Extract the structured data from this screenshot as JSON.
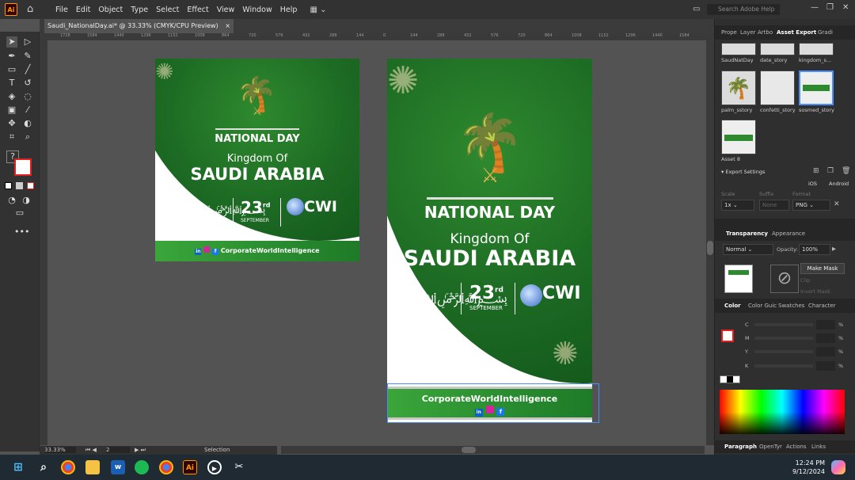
{
  "app": {
    "logo": "Ai",
    "menu": [
      "File",
      "Edit",
      "Object",
      "Type",
      "Select",
      "Effect",
      "View",
      "Window",
      "Help"
    ],
    "search_placeholder": "Search Adobe Help"
  },
  "document": {
    "tab_title": "Saudi_NationalDay.ai* @ 33.33% (CMYK/CPU Preview)",
    "close": "×"
  },
  "ruler": {
    "h_labels": [
      "1728",
      "1584",
      "1440",
      "1296",
      "1152",
      "1008",
      "864",
      "720",
      "576",
      "432",
      "288",
      "144",
      "0",
      "144",
      "288",
      "432",
      "576",
      "720",
      "864",
      "1008",
      "1152",
      "1296",
      "1440",
      "1584"
    ]
  },
  "artboard_small": {
    "national_day": "NATIONAL DAY",
    "kingdom_of": "Kingdom Of",
    "saudi_arabia": "SAUDI ARABIA",
    "day": "23",
    "day_sup": "rd",
    "month": "SEPTEMBER",
    "logo": "CWI",
    "footer": "CorporateWorldIntelligence"
  },
  "artboard_story": {
    "national_day": "NATIONAL DAY",
    "kingdom_of": "Kingdom Of",
    "saudi_arabia": "SAUDI ARABIA",
    "day": "23",
    "day_sup": "rd",
    "month": "SEPTEMBER",
    "logo": "CWI",
    "footer": "CorporateWorldIntelligence"
  },
  "status": {
    "zoom": "33.33%",
    "page": "2",
    "mode": "Selection"
  },
  "panel": {
    "tabs": [
      "Prope",
      "Layer",
      "Artbo",
      "Asset Export",
      "Gradi"
    ],
    "assets": [
      {
        "label": "SaudNatDay"
      },
      {
        "label": "date_story"
      },
      {
        "label": "kingdom_s..."
      },
      {
        "label": "palm_sstory"
      },
      {
        "label": "confetti_story"
      },
      {
        "label": "sosmed_story"
      },
      {
        "label": "Asset 8"
      }
    ],
    "export_settings": "Export Settings",
    "ios": "iOS",
    "android": "Android",
    "scale_label": "Scale",
    "suffix_label": "Suffix",
    "format_label": "Format",
    "scale_value": "1x",
    "suffix_placeholder": "None",
    "format_value": "PNG",
    "transparency_tabs": [
      "Transparency",
      "Appearance"
    ],
    "blend_mode": "Normal",
    "opacity_label": "Opacity:",
    "opacity_value": "100%",
    "make_mask": "Make Mask",
    "clip": "Clip",
    "invert_mask": "Invert Mask",
    "color_tabs": [
      "Color",
      "Color Guic",
      "Swatches",
      "Character"
    ],
    "cmyk": [
      "C",
      "M",
      "Y",
      "K"
    ],
    "percent": "%",
    "bottom_tabs": [
      "Paragraph",
      "OpenTyr",
      "Actions",
      "Links"
    ]
  },
  "taskbar": {
    "time": "12:24 PM",
    "date": "9/12/2024",
    "ai_icon": "Ai"
  },
  "colors": {
    "green": "#1d6b24",
    "gold": "#d9b04e",
    "footer_green": "#3aa63a"
  }
}
